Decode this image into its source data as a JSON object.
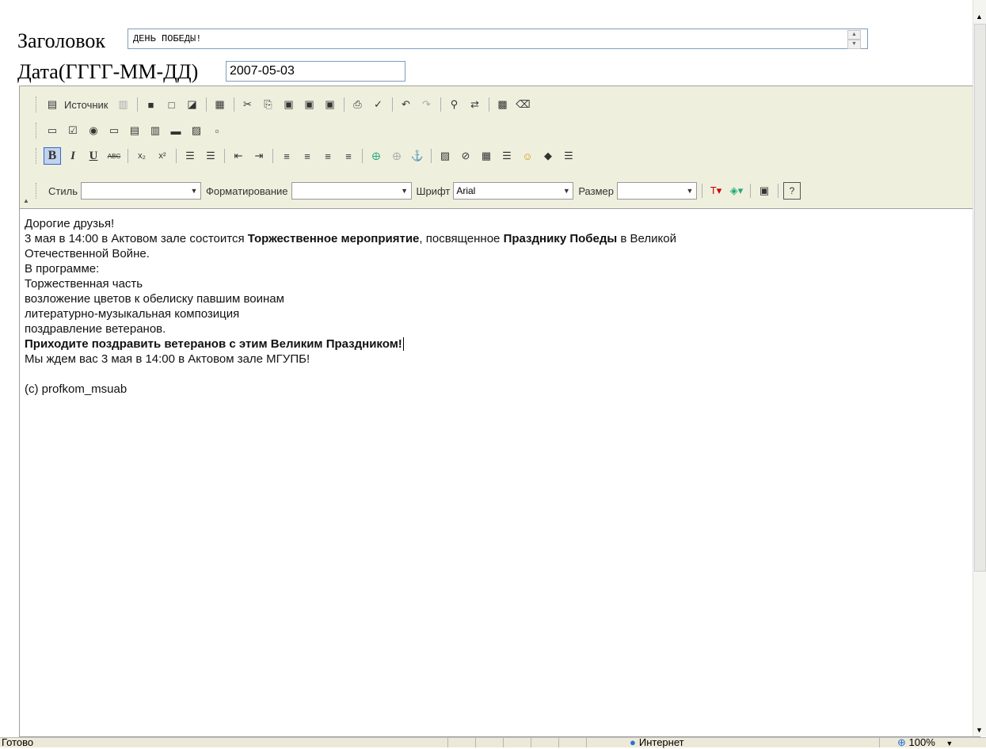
{
  "form": {
    "title_label": "Заголовок",
    "title_value": "ДЕНЬ ПОБЕДЫ!",
    "date_label": "Дата(ГГГГ-ММ-ДД)",
    "date_value": "2007-05-03"
  },
  "toolbar": {
    "source_label": "Источник",
    "style_label": "Стиль",
    "style_value": "",
    "format_label": "Форматирование",
    "format_value": "",
    "font_label": "Шрифт",
    "font_value": "Arial",
    "size_label": "Размер",
    "size_value": "",
    "bold_glyph": "B",
    "italic_glyph": "I",
    "underline_glyph": "U",
    "strike_glyph": "ABC",
    "help_glyph": "?"
  },
  "content": {
    "line1": "Дорогие друзья!",
    "line2_a": "3 мая в 14:00 в Актовом зале состоится ",
    "line2_b": "Торжественное мероприятие",
    "line2_c": ", посвященное ",
    "line2_d": "Празднику Победы",
    "line2_e": " в Великой",
    "line3": "Отечественной Войне.",
    "line4": "В программе:",
    "line5": "Торжественная часть",
    "line6": "возложение цветов к обелиску павшим воинам",
    "line7": "литературно-музыкальная композиция",
    "line8": "поздравление ветеранов.",
    "line9": "Приходите поздравить ветеранов с этим Великим Праздником!",
    "line10": "Мы ждем вас 3 мая в 14:00 в Актовом зале МГУПБ!",
    "line11": "",
    "line12": "(c) profkom_msuab"
  },
  "status": {
    "ready": "Готово",
    "zone": "Интернет",
    "zoom": "100%"
  },
  "colors": {
    "toolbar_bg": "#efefde",
    "active_button": "#c1d2ee",
    "status_bg": "#ece9d8"
  }
}
